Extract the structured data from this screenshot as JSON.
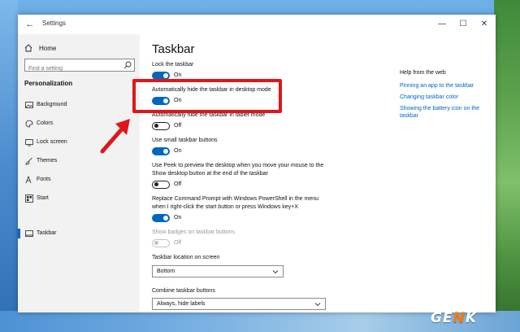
{
  "window": {
    "title": "Settings",
    "back_glyph": "←",
    "minimize_glyph": "—",
    "maximize_glyph": "☐",
    "close_glyph": "✕"
  },
  "sidebar": {
    "home_label": "Home",
    "search_placeholder": "Find a setting",
    "section_heading": "Personalization",
    "items": [
      {
        "label": "Background",
        "icon": "image-icon"
      },
      {
        "label": "Colors",
        "icon": "palette-icon"
      },
      {
        "label": "Lock screen",
        "icon": "lock-screen-icon"
      },
      {
        "label": "Themes",
        "icon": "brush-icon"
      },
      {
        "label": "Fonts",
        "icon": "font-icon"
      },
      {
        "label": "Start",
        "icon": "start-icon"
      },
      {
        "label": "Taskbar",
        "icon": "taskbar-icon",
        "active": true
      }
    ]
  },
  "main": {
    "page_title": "Taskbar",
    "settings": [
      {
        "label": "Lock the taskbar",
        "state": "On"
      },
      {
        "label": "Automatically hide the taskbar in desktop mode",
        "state": "On"
      },
      {
        "label": "Automatically hide the taskbar in tablet mode",
        "state": "Off"
      },
      {
        "label": "Use small taskbar buttons",
        "state": "On"
      },
      {
        "label": "Use Peek to preview the desktop when you move your mouse to the Show desktop button at the end of the taskbar",
        "state": "Off"
      },
      {
        "label": "Replace Command Prompt with Windows PowerShell in the menu when I right-click the start button or press Windows key+X",
        "state": "On"
      },
      {
        "label": "Show badges on taskbar buttons",
        "state": "Off"
      }
    ],
    "location_label": "Taskbar location on screen",
    "location_value": "Bottom",
    "combine_label": "Combine taskbar buttons",
    "combine_value": "Always, hide labels"
  },
  "help": {
    "title": "Help from the web",
    "links": [
      "Pinning an app to the taskbar",
      "Changing taskbar color",
      "Showing the battery icon on the taskbar"
    ]
  },
  "watermark": {
    "text_pre": "GE",
    "text_n": "N",
    "text_post": "K"
  },
  "colors": {
    "accent": "#0067c0",
    "highlight": "#e0151b"
  }
}
